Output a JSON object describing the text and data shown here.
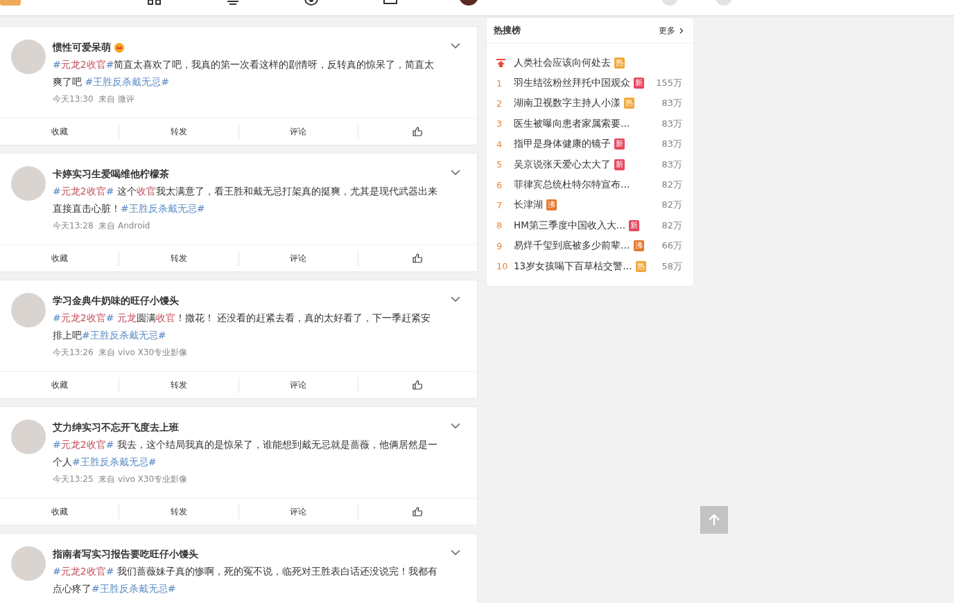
{
  "posts": [
    {
      "author": "惯性可爱呆萌",
      "crown": true,
      "text": [
        {
          "kind": "link",
          "text": "#"
        },
        {
          "kind": "keyword",
          "text": "元龙2收官"
        },
        {
          "kind": "link",
          "text": "#"
        },
        {
          "kind": "plain",
          "text": "简直太喜欢了吧，我真的第一次看这样的剧情呀，反转真的惊呆了，简直太爽了吧 "
        },
        {
          "kind": "link",
          "text": "#王胜反杀戴无忌#"
        }
      ],
      "meta": "今天13:30  来自 微评",
      "actions": [
        "收藏",
        "转发",
        "评论"
      ]
    },
    {
      "author": "卡婷实习生爱喝维他柠檬茶",
      "crown": false,
      "text": [
        {
          "kind": "link",
          "text": "#"
        },
        {
          "kind": "keyword",
          "text": "元龙2收官"
        },
        {
          "kind": "link",
          "text": "#"
        },
        {
          "kind": "plain",
          "text": " 这个"
        },
        {
          "kind": "keyword",
          "text": "收官"
        },
        {
          "kind": "plain",
          "text": "我太满意了，看王胜和戴无忌打架真的挺爽，尤其是现代武器出来直接直击心脏！"
        },
        {
          "kind": "link",
          "text": "#王胜反杀戴无忌#"
        }
      ],
      "meta": "今天13:28  来自 Android",
      "actions": [
        "收藏",
        "转发",
        "评论"
      ]
    },
    {
      "author": "学习金典牛奶味的旺仔小馒头",
      "crown": false,
      "text": [
        {
          "kind": "link",
          "text": "#"
        },
        {
          "kind": "keyword",
          "text": "元龙2收官"
        },
        {
          "kind": "link",
          "text": "# "
        },
        {
          "kind": "keyword",
          "text": "元龙"
        },
        {
          "kind": "plain",
          "text": "圆满"
        },
        {
          "kind": "keyword",
          "text": "收官"
        },
        {
          "kind": "plain",
          "text": "！撒花！ 还没看的赶紧去看，真的太好看了，下一季赶紧安排上吧"
        },
        {
          "kind": "link",
          "text": "#王胜反杀戴无忌#"
        }
      ],
      "meta": "今天13:26  来自 vivo X30专业影像",
      "actions": [
        "收藏",
        "转发",
        "评论"
      ]
    },
    {
      "author": "艾力绅实习不忘开飞度去上班",
      "crown": false,
      "text": [
        {
          "kind": "link",
          "text": "#"
        },
        {
          "kind": "keyword",
          "text": "元龙2收官"
        },
        {
          "kind": "link",
          "text": "#"
        },
        {
          "kind": "plain",
          "text": " 我去，这个结局我真的是惊呆了，谁能想到戴无忌就是蔷薇，他俩居然是一个人"
        },
        {
          "kind": "link",
          "text": "#王胜反杀戴无忌#"
        }
      ],
      "meta": "今天13:25  来自 vivo X30专业影像",
      "actions": [
        "收藏",
        "转发",
        "评论"
      ]
    },
    {
      "author": "指南者写实习报告要吃旺仔小馒头",
      "crown": false,
      "text": [
        {
          "kind": "link",
          "text": "#"
        },
        {
          "kind": "keyword",
          "text": "元龙2收官"
        },
        {
          "kind": "link",
          "text": "#"
        },
        {
          "kind": "plain",
          "text": " 我们蔷薇妹子真的惨啊，死的冤不说，临死对王胜表白话还没说完！我都有点心疼了"
        },
        {
          "kind": "link",
          "text": "#王胜反杀戴无忌#"
        }
      ]
    }
  ],
  "hot_search": {
    "title": "热搜榜",
    "more": "更多",
    "items": [
      {
        "kind": "pinned",
        "title": "人类社会应该向何处去",
        "badge": {
          "text": "热",
          "color": "#f2a83b"
        }
      },
      {
        "kind": "ranked",
        "rank": "1",
        "title": "羽生结弦粉丝拜托中国观众",
        "badge": {
          "text": "新",
          "color": "#e8465e"
        },
        "count": "155万"
      },
      {
        "kind": "ranked",
        "rank": "2",
        "title": "湖南卫视数字主持人小漾",
        "badge": {
          "text": "热",
          "color": "#f2a83b"
        },
        "count": "83万"
      },
      {
        "kind": "ranked",
        "rank": "3",
        "title": "医生被曝向患者家属索要…",
        "count": "83万"
      },
      {
        "kind": "ranked",
        "rank": "4",
        "title": "指甲是身体健康的镜子",
        "badge": {
          "text": "新",
          "color": "#e8465e"
        },
        "count": "83万"
      },
      {
        "kind": "ranked",
        "rank": "5",
        "title": "吴京说张天爱心太大了",
        "badge": {
          "text": "新",
          "color": "#e8465e"
        },
        "count": "83万"
      },
      {
        "kind": "ranked",
        "rank": "6",
        "title": "菲律宾总统杜特尔特宣布…",
        "count": "82万"
      },
      {
        "kind": "ranked",
        "rank": "7",
        "title": "长津湖",
        "badge": {
          "text": "沸",
          "color": "#e5792a"
        },
        "count": "82万"
      },
      {
        "kind": "ranked",
        "rank": "8",
        "title": "HM第三季度中国收入大…",
        "badge": {
          "text": "新",
          "color": "#e8465e"
        },
        "count": "82万"
      },
      {
        "kind": "ranked",
        "rank": "9",
        "title": "易烊千玺到底被多少前辈…",
        "badge": {
          "text": "沸",
          "color": "#e5792a"
        },
        "count": "66万"
      },
      {
        "kind": "ranked",
        "rank": "10",
        "title": "13岁女孩喝下百草枯交警…",
        "badge": {
          "text": "热",
          "color": "#f2a83b"
        },
        "count": "58万"
      }
    ]
  }
}
